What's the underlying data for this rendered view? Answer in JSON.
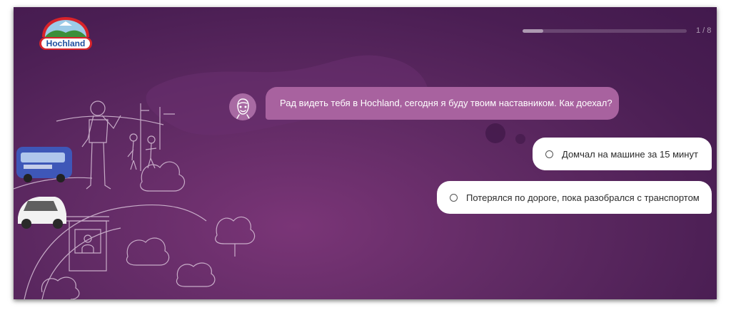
{
  "brand": {
    "logo_text": "Hochland",
    "logo_colors": {
      "red": "#d8232a",
      "blue": "#1f4fa0",
      "green": "#3c8f3a",
      "sky": "#9ccbe8"
    }
  },
  "progress": {
    "current": 1,
    "total": 8,
    "fraction": 0.125,
    "label": "1 / 8"
  },
  "chat": {
    "mentor_avatar_icon": "mentor-face-icon",
    "message": "Рад видеть тебя в Hochland, сегодня я буду твоим наставником. Как доехал?"
  },
  "options": [
    {
      "label": "Домчал на машине за 15 минут",
      "selected": false
    },
    {
      "label": "Потерялся по дороге, пока разобрался с транспортом",
      "selected": false
    }
  ],
  "theme": {
    "background": "#5f2a63",
    "bubble": "#a8629f",
    "option_bg": "#ffffff",
    "line_art": "#d9c2d9"
  }
}
